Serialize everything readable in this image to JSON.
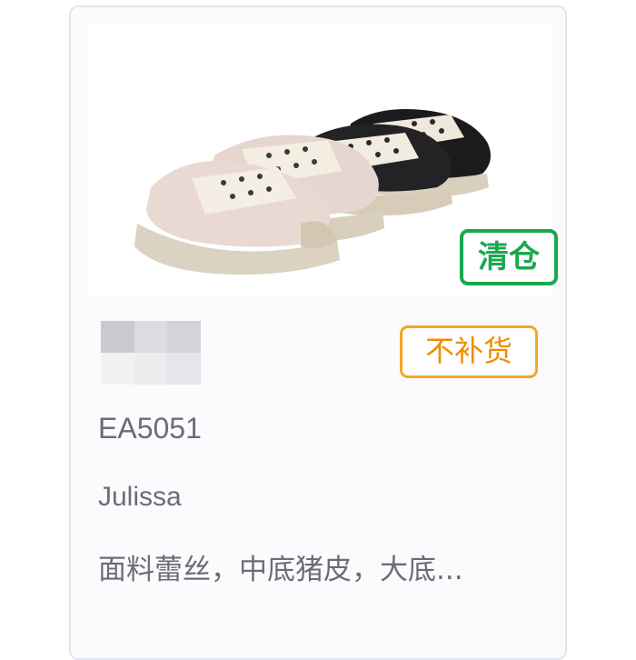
{
  "card": {
    "tags": {
      "clearance": "清仓",
      "no_restock": "不补货"
    },
    "sku": "EA5051",
    "brand": "Julissa",
    "description": "面料蕾丝，中底猪皮，大底..."
  },
  "icons": {
    "product_image": "shoe-image",
    "blurred": "blurred-avatar"
  },
  "colors": {
    "clearance": "#1aa84f",
    "no_restock": "#f08c00",
    "text": "#6a6d75",
    "border": "#e3e6ee"
  }
}
